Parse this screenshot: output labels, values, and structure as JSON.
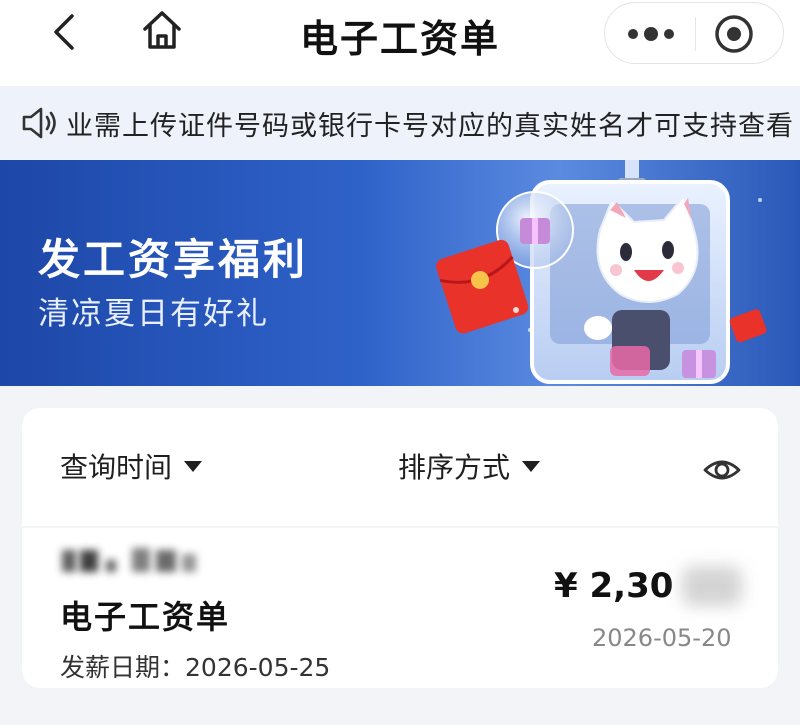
{
  "nav": {
    "title": "电子工资单",
    "back_icon": "chevron-left-icon",
    "home_icon": "home-icon",
    "more_icon": "more-dots-icon",
    "close_icon": "target-close-icon"
  },
  "notice": {
    "icon": "speaker-icon",
    "text": "业需上传证件号码或银行卡号对应的真实姓名才可支持查看"
  },
  "banner": {
    "title": "发工资享福利",
    "subtitle": "清凉夏日有好礼"
  },
  "filters": {
    "time_label": "查询时间",
    "sort_label": "排序方式",
    "eye_icon": "eye-icon"
  },
  "payslip": {
    "title": "电子工资单",
    "amount_visible": "¥ 2,30",
    "issue_date": "2026-05-20",
    "pay_date_label": "发薪日期：",
    "pay_date": "2026-05-25"
  },
  "colors": {
    "banner_blue": "#1d47a8",
    "notice_bg": "#eef3fb",
    "page_bg": "#f2f4f8"
  }
}
